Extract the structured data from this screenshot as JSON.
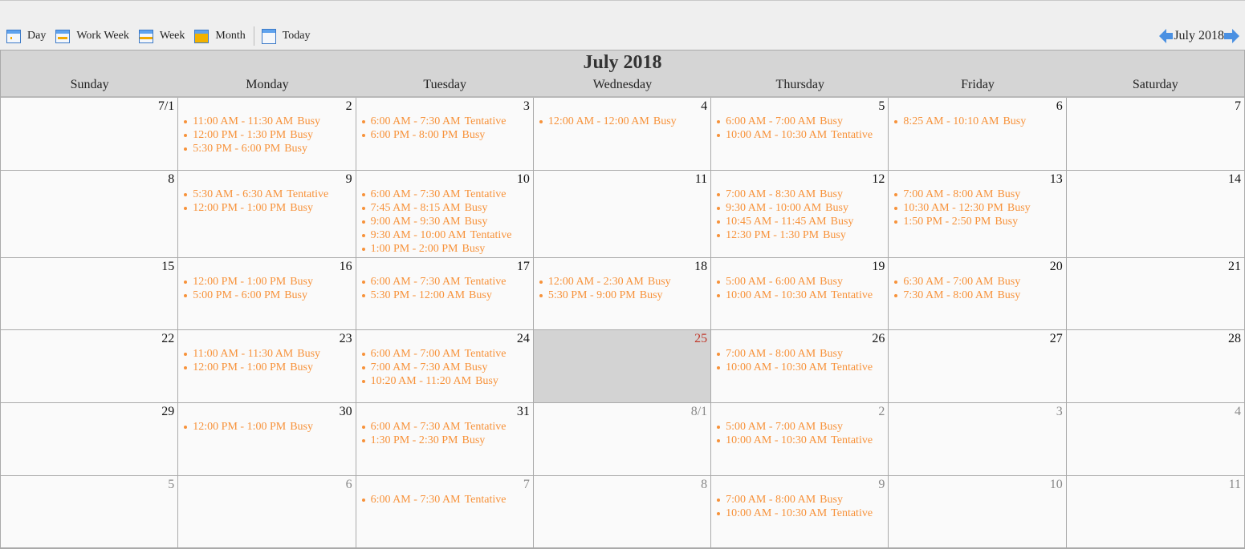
{
  "toolbar": {
    "buttons": [
      {
        "label": "Day",
        "icon": "day-view-icon"
      },
      {
        "label": "Work Week",
        "icon": "work-week-view-icon"
      },
      {
        "label": "Week",
        "icon": "week-view-icon"
      },
      {
        "label": "Month",
        "icon": "month-view-icon"
      },
      {
        "label": "Today",
        "icon": "today-calendar-icon"
      }
    ]
  },
  "nav": {
    "title": "July 2018"
  },
  "calendar": {
    "title": "July 2018",
    "days_of_week": [
      "Sunday",
      "Monday",
      "Tuesday",
      "Wednesday",
      "Thursday",
      "Friday",
      "Saturday"
    ],
    "colors": {
      "event": "#f7923a",
      "today_bg": "#d3d3d3",
      "today_date": "#c0392b",
      "other_month_date": "#888888"
    },
    "weeks": [
      [
        {
          "date": "7/1",
          "events": []
        },
        {
          "date": "2",
          "events": [
            {
              "time": "11:00 AM - 11:30 AM",
              "status": "Busy"
            },
            {
              "time": "12:00 PM - 1:30 PM",
              "status": "Busy"
            },
            {
              "time": "5:30 PM - 6:00 PM",
              "status": "Busy"
            }
          ]
        },
        {
          "date": "3",
          "events": [
            {
              "time": "6:00 AM - 7:30 AM",
              "status": "Tentative"
            },
            {
              "time": "6:00 PM - 8:00 PM",
              "status": "Busy"
            }
          ]
        },
        {
          "date": "4",
          "events": [
            {
              "time": "12:00 AM - 12:00 AM",
              "status": "Busy"
            }
          ]
        },
        {
          "date": "5",
          "events": [
            {
              "time": "6:00 AM - 7:00 AM",
              "status": "Busy"
            },
            {
              "time": "10:00 AM - 10:30 AM",
              "status": "Tentative"
            }
          ]
        },
        {
          "date": "6",
          "events": [
            {
              "time": "8:25 AM - 10:10 AM",
              "status": "Busy"
            }
          ]
        },
        {
          "date": "7",
          "events": []
        }
      ],
      [
        {
          "date": "8",
          "events": []
        },
        {
          "date": "9",
          "events": [
            {
              "time": "5:30 AM - 6:30 AM",
              "status": "Tentative"
            },
            {
              "time": "12:00 PM - 1:00 PM",
              "status": "Busy"
            }
          ]
        },
        {
          "date": "10",
          "events": [
            {
              "time": "6:00 AM - 7:30 AM",
              "status": "Tentative"
            },
            {
              "time": "7:45 AM - 8:15 AM",
              "status": "Busy"
            },
            {
              "time": "9:00 AM - 9:30 AM",
              "status": "Busy"
            },
            {
              "time": "9:30 AM - 10:00 AM",
              "status": "Tentative"
            },
            {
              "time": "1:00 PM - 2:00 PM",
              "status": "Busy"
            }
          ]
        },
        {
          "date": "11",
          "events": []
        },
        {
          "date": "12",
          "events": [
            {
              "time": "7:00 AM - 8:30 AM",
              "status": "Busy"
            },
            {
              "time": "9:30 AM - 10:00 AM",
              "status": "Busy"
            },
            {
              "time": "10:45 AM - 11:45 AM",
              "status": "Busy"
            },
            {
              "time": "12:30 PM - 1:30 PM",
              "status": "Busy"
            }
          ]
        },
        {
          "date": "13",
          "events": [
            {
              "time": "7:00 AM - 8:00 AM",
              "status": "Busy"
            },
            {
              "time": "10:30 AM - 12:30 PM",
              "status": "Busy"
            },
            {
              "time": "1:50 PM - 2:50 PM",
              "status": "Busy"
            }
          ]
        },
        {
          "date": "14",
          "events": []
        }
      ],
      [
        {
          "date": "15",
          "events": []
        },
        {
          "date": "16",
          "events": [
            {
              "time": "12:00 PM - 1:00 PM",
              "status": "Busy"
            },
            {
              "time": "5:00 PM - 6:00 PM",
              "status": "Busy"
            }
          ]
        },
        {
          "date": "17",
          "events": [
            {
              "time": "6:00 AM - 7:30 AM",
              "status": "Tentative"
            },
            {
              "time": "5:30 PM - 12:00 AM",
              "status": "Busy"
            }
          ]
        },
        {
          "date": "18",
          "events": [
            {
              "time": "12:00 AM - 2:30 AM",
              "status": "Busy"
            },
            {
              "time": "5:30 PM - 9:00 PM",
              "status": "Busy"
            }
          ]
        },
        {
          "date": "19",
          "events": [
            {
              "time": "5:00 AM - 6:00 AM",
              "status": "Busy"
            },
            {
              "time": "10:00 AM - 10:30 AM",
              "status": "Tentative"
            }
          ]
        },
        {
          "date": "20",
          "events": [
            {
              "time": "6:30 AM - 7:00 AM",
              "status": "Busy"
            },
            {
              "time": "7:30 AM - 8:00 AM",
              "status": "Busy"
            }
          ]
        },
        {
          "date": "21",
          "events": []
        }
      ],
      [
        {
          "date": "22",
          "events": []
        },
        {
          "date": "23",
          "events": [
            {
              "time": "11:00 AM - 11:30 AM",
              "status": "Busy"
            },
            {
              "time": "12:00 PM - 1:00 PM",
              "status": "Busy"
            }
          ]
        },
        {
          "date": "24",
          "events": [
            {
              "time": "6:00 AM - 7:00 AM",
              "status": "Tentative"
            },
            {
              "time": "7:00 AM - 7:30 AM",
              "status": "Busy"
            },
            {
              "time": "10:20 AM - 11:20 AM",
              "status": "Busy"
            }
          ]
        },
        {
          "date": "25",
          "today": true,
          "events": []
        },
        {
          "date": "26",
          "events": [
            {
              "time": "7:00 AM - 8:00 AM",
              "status": "Busy"
            },
            {
              "time": "10:00 AM - 10:30 AM",
              "status": "Tentative"
            }
          ]
        },
        {
          "date": "27",
          "events": []
        },
        {
          "date": "28",
          "events": []
        }
      ],
      [
        {
          "date": "29",
          "events": []
        },
        {
          "date": "30",
          "events": [
            {
              "time": "12:00 PM - 1:00 PM",
              "status": "Busy"
            }
          ]
        },
        {
          "date": "31",
          "events": [
            {
              "time": "6:00 AM - 7:30 AM",
              "status": "Tentative"
            },
            {
              "time": "1:30 PM - 2:30 PM",
              "status": "Busy"
            }
          ]
        },
        {
          "date": "8/1",
          "other": true,
          "events": []
        },
        {
          "date": "2",
          "other": true,
          "events": [
            {
              "time": "5:00 AM - 7:00 AM",
              "status": "Busy"
            },
            {
              "time": "10:00 AM - 10:30 AM",
              "status": "Tentative"
            }
          ]
        },
        {
          "date": "3",
          "other": true,
          "events": []
        },
        {
          "date": "4",
          "other": true,
          "events": []
        }
      ],
      [
        {
          "date": "5",
          "other": true,
          "events": []
        },
        {
          "date": "6",
          "other": true,
          "events": []
        },
        {
          "date": "7",
          "other": true,
          "events": [
            {
              "time": "6:00 AM - 7:30 AM",
              "status": "Tentative"
            }
          ]
        },
        {
          "date": "8",
          "other": true,
          "events": []
        },
        {
          "date": "9",
          "other": true,
          "events": [
            {
              "time": "7:00 AM - 8:00 AM",
              "status": "Busy"
            },
            {
              "time": "10:00 AM - 10:30 AM",
              "status": "Tentative"
            }
          ]
        },
        {
          "date": "10",
          "other": true,
          "events": []
        },
        {
          "date": "11",
          "other": true,
          "events": []
        }
      ]
    ]
  }
}
